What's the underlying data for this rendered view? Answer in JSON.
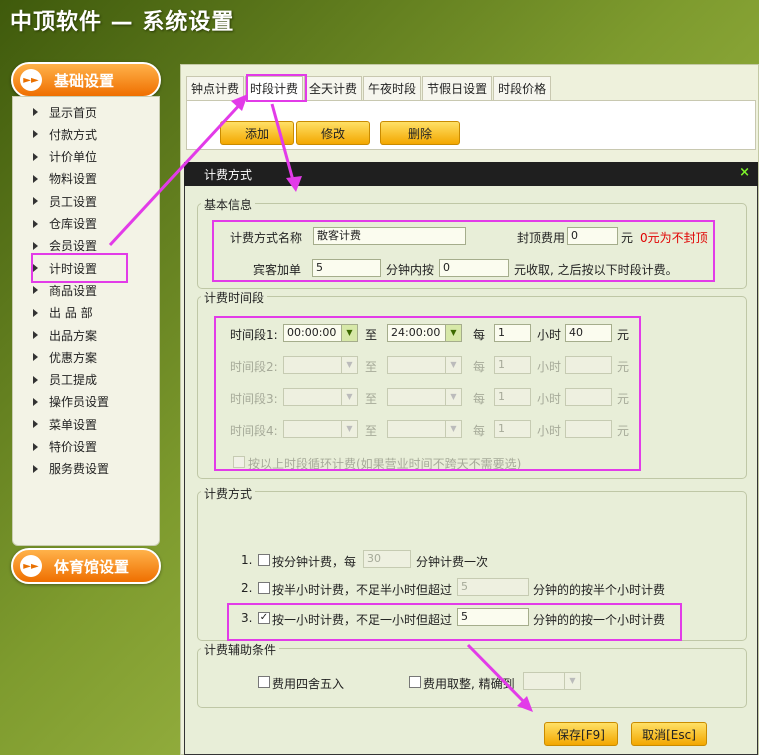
{
  "app": {
    "title": "中顶软件 — 系统设置"
  },
  "sidebar": {
    "basic_label": "基础设置",
    "items": [
      "显示首页",
      "付款方式",
      "计价单位",
      "物料设置",
      "员工设置",
      "仓库设置",
      "会员设置",
      "计时设置",
      "商品设置",
      "出 品 部",
      "出品方案",
      "优惠方案",
      "员工提成",
      "操作员设置",
      "菜单设置",
      "特价设置",
      "服务费设置"
    ],
    "selected": "计时设置",
    "gym_label": "体育馆设置"
  },
  "tabs": [
    "钟点计费",
    "时段计费",
    "全天计费",
    "午夜时段",
    "节假日设置",
    "时段价格"
  ],
  "active_tab": "时段计费",
  "toolbar": {
    "add": "添加",
    "edit": "修改",
    "delete": "删除"
  },
  "dialog": {
    "title": "计费方式",
    "close_icon": "×",
    "basic_info": {
      "group_title": "基本信息",
      "name_label": "计费方式名称",
      "name_value": "散客计费",
      "cap_label": "封顶费用",
      "cap_value": "0",
      "cap_unit": "元",
      "cap_note": "0元为不封顶",
      "extra_label": "宾客加单",
      "extra_value": "5",
      "extra_mid": "分钟内按",
      "extra_price": "0",
      "extra_suffix": "元收取, 之后按以下时段计费。"
    },
    "periods": {
      "group_title": "计费时间段",
      "rows": [
        {
          "label": "时间段1:",
          "start": "00:00:00",
          "to": "至",
          "end": "24:00:00",
          "per": "每",
          "hours": "1",
          "hour_unit": "小时",
          "price": "40",
          "yuan": "元",
          "enabled": true
        },
        {
          "label": "时间段2:",
          "start": "",
          "to": "至",
          "end": "",
          "per": "每",
          "hours": "1",
          "hour_unit": "小时",
          "price": "",
          "yuan": "元",
          "enabled": false
        },
        {
          "label": "时间段3:",
          "start": "",
          "to": "至",
          "end": "",
          "per": "每",
          "hours": "1",
          "hour_unit": "小时",
          "price": "",
          "yuan": "元",
          "enabled": false
        },
        {
          "label": "时间段4:",
          "start": "",
          "to": "至",
          "end": "",
          "per": "每",
          "hours": "1",
          "hour_unit": "小时",
          "price": "",
          "yuan": "元",
          "enabled": false
        }
      ],
      "loop_label": "按以上时段循环计费(如果营业时间不跨天不需要选)"
    },
    "method": {
      "group_title": "计费方式",
      "opt1": {
        "num": "1.",
        "label": "按分钟计费，每",
        "value": "30",
        "suffix": "分钟计费一次",
        "checked": false
      },
      "opt2": {
        "num": "2.",
        "label": "按半小时计费，不足半小时但超过",
        "value": "5",
        "suffix": "分钟的的按半个小时计费",
        "checked": false
      },
      "opt3": {
        "num": "3.",
        "label": "按一小时计费，不足一小时但超过",
        "value": "5",
        "suffix": "分钟的的按一个小时计费",
        "checked": true
      }
    },
    "aux": {
      "group_title": "计费辅助条件",
      "round_label": "费用四舍五入",
      "int_label": "费用取整, 精确到",
      "int_value": ""
    },
    "save": "保存[F9]",
    "cancel": "取消[Esc]"
  },
  "colors": {
    "highlight": "#e23be8",
    "accent_orange": "#ef6f00",
    "note_red": "#e00000"
  }
}
